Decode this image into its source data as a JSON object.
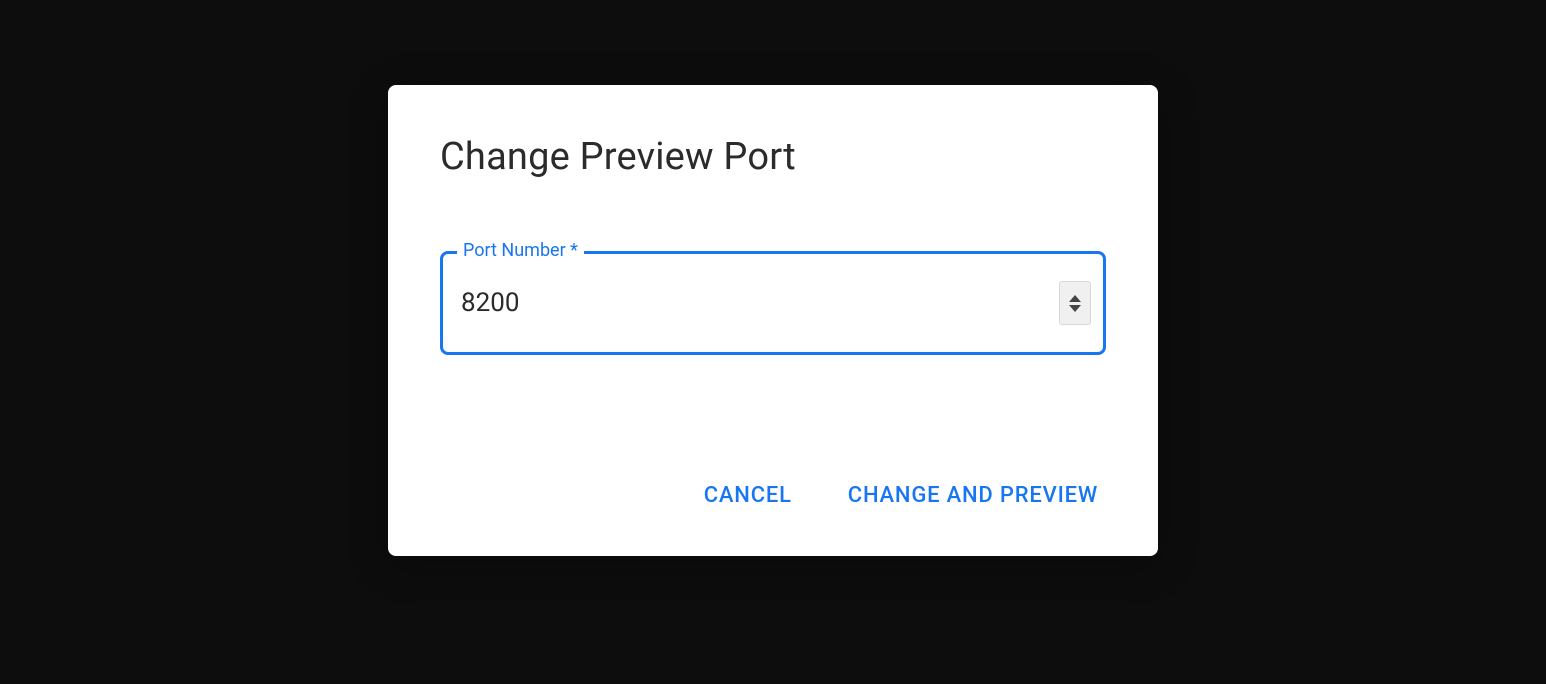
{
  "dialog": {
    "title": "Change Preview Port",
    "field": {
      "label": "Port Number *",
      "value": "8200"
    },
    "actions": {
      "cancel": "CANCEL",
      "confirm": "CHANGE AND PREVIEW"
    }
  }
}
